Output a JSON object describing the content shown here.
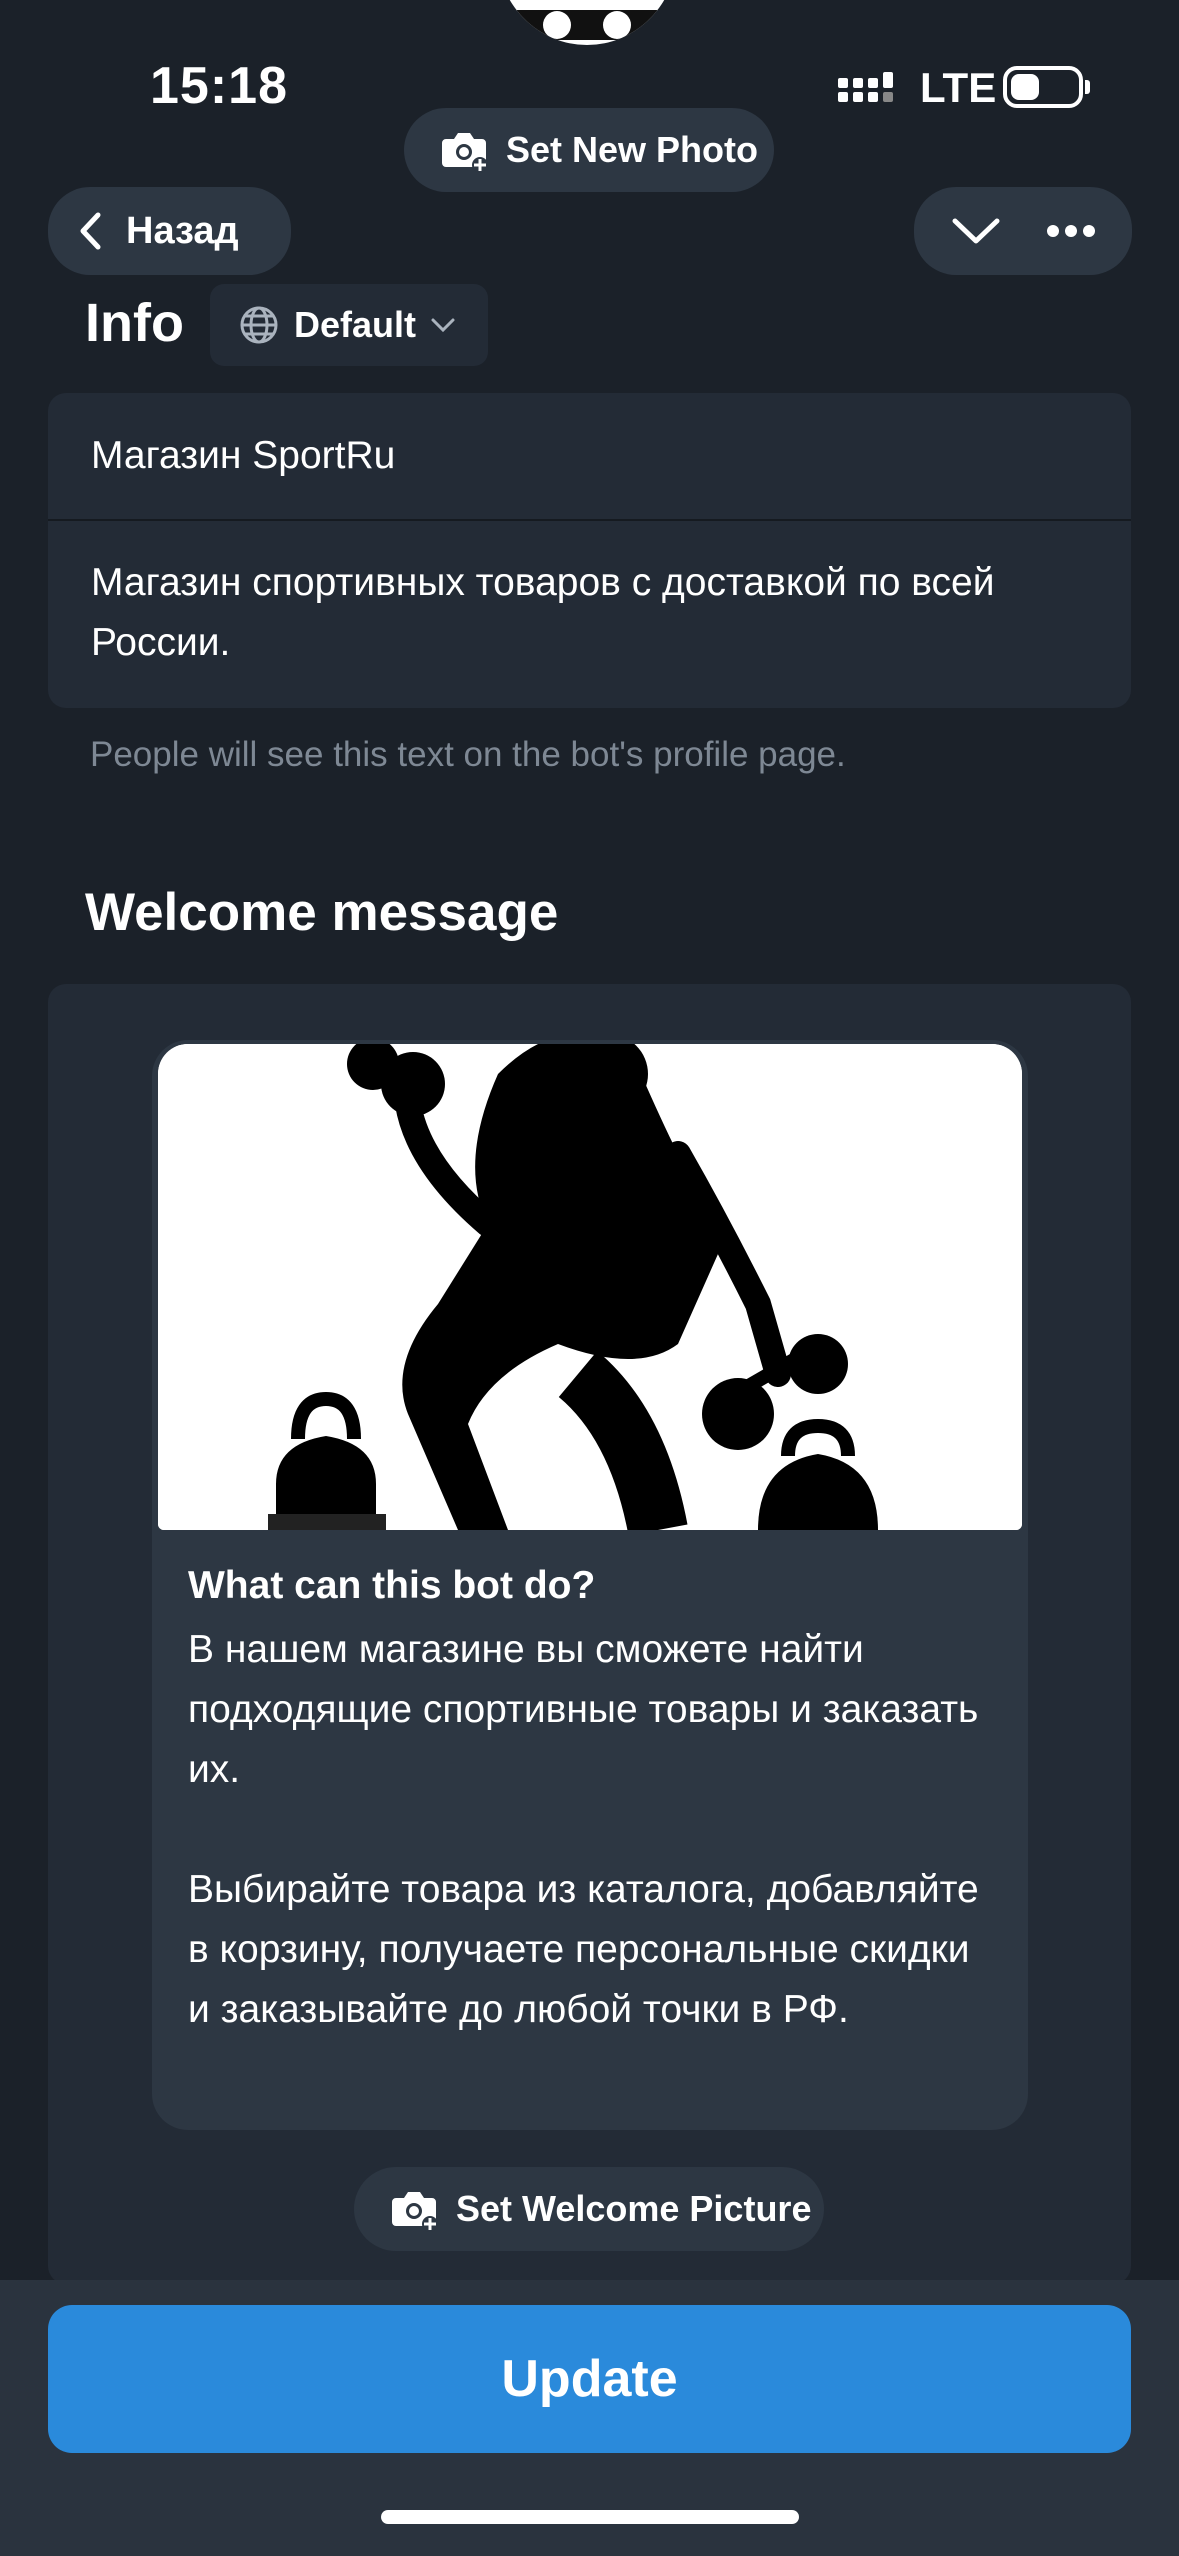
{
  "status_bar": {
    "time": "15:18",
    "network": "LTE"
  },
  "header": {
    "set_photo_label": "Set New Photo",
    "back_label": "Назад",
    "chevron_icon": "chevron-down-icon",
    "more_icon": "more-icon"
  },
  "info": {
    "title": "Info",
    "language": "Default",
    "name": "Магазин SportRu",
    "description": "Магазин спортивных товаров с доставкой по всей России.",
    "hint": "People will see this text on the bot's profile page."
  },
  "welcome": {
    "title": "Welcome message",
    "bubble_title": "What can this bot do?",
    "bubble_text": "В нашем магазине вы сможете найти подходящие спортивные товары и заказать их.\n\nВыбирайте товара из каталога, добавляйте в корзину, получаете персональные скидки и заказывайте до любой точки в РФ.",
    "set_picture_label": "Set Welcome Picture"
  },
  "actions": {
    "update_label": "Update"
  },
  "colors": {
    "background": "#1b2129",
    "card": "#232b36",
    "accent": "#2a8adb"
  }
}
